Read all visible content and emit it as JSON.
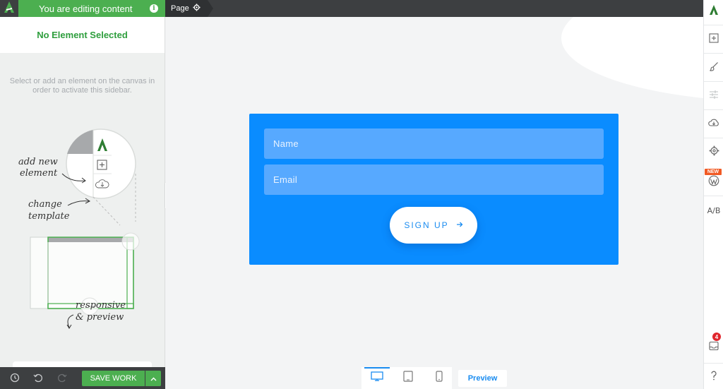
{
  "header": {
    "editing_banner": "You are editing content",
    "page_tab": "Page"
  },
  "sidebar": {
    "title": "No Element Selected",
    "hint": "Select or add an element on the canvas in order to activate this sidebar.",
    "annotations": {
      "add_new_element": "add new element",
      "change_template": "change template",
      "responsive_preview": "responsive & preview"
    }
  },
  "footer": {
    "save_label": "SAVE WORK",
    "preview_label": "Preview"
  },
  "form": {
    "name_placeholder": "Name",
    "email_placeholder": "Email",
    "signup_label": "SIGN UP"
  },
  "rightbar": {
    "new_badge": "NEW",
    "notification_count": "4",
    "ab_label": "A/B"
  },
  "colors": {
    "banner_green": "#4caf50",
    "form_blue": "#0a8cff",
    "field_blue": "#57a9ff",
    "accent_blue": "#1a8cf0",
    "new_badge_orange": "#f15a24"
  },
  "icons": {
    "logo": "thrive-logo-icon",
    "info": "info-icon",
    "page_settings": "gear-icon",
    "history": "clock-icon",
    "undo": "undo-icon",
    "redo": "redo-icon",
    "save_options": "chevron-up-icon",
    "desktop": "desktop-icon",
    "tablet": "tablet-icon",
    "mobile": "mobile-icon"
  }
}
